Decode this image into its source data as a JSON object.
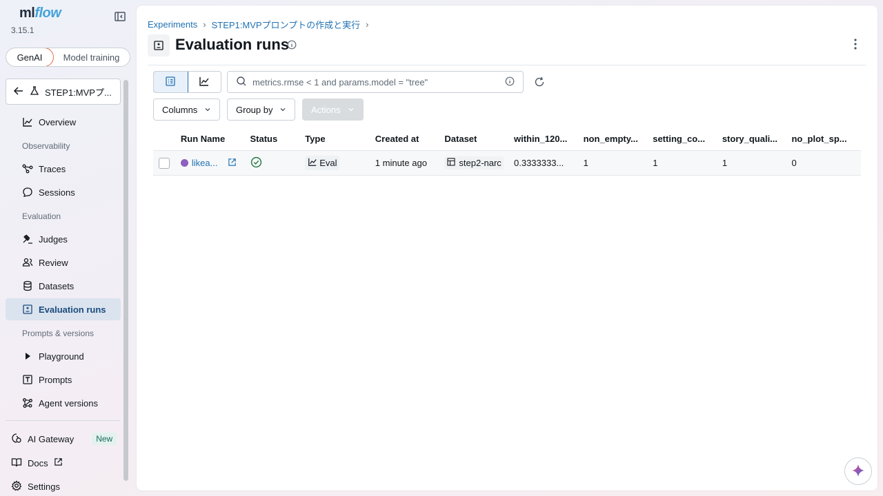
{
  "app": {
    "logo_ml": "ml",
    "logo_flow": "flow",
    "version": "3.15.1"
  },
  "mode_toggle": {
    "options": [
      "GenAI",
      "Model training"
    ],
    "selected": "GenAI"
  },
  "experiment_button": {
    "label": "STEP1:MVPプ..."
  },
  "sidebar": {
    "overview": "Overview",
    "section_observability": "Observability",
    "traces": "Traces",
    "sessions": "Sessions",
    "section_evaluation": "Evaluation",
    "judges": "Judges",
    "review": "Review",
    "datasets": "Datasets",
    "evaluation_runs": "Evaluation runs",
    "section_prompts": "Prompts & versions",
    "playground": "Playground",
    "prompts": "Prompts",
    "agent_versions": "Agent versions",
    "ai_gateway": "AI Gateway",
    "ai_gateway_badge": "New",
    "docs": "Docs",
    "settings": "Settings"
  },
  "breadcrumb": {
    "items": [
      "Experiments",
      "STEP1:MVPプロンプトの作成と実行"
    ]
  },
  "page": {
    "title": "Evaluation runs"
  },
  "toolbar": {
    "search_placeholder": "metrics.rmse < 1 and params.model = \"tree\"",
    "columns_label": "Columns",
    "group_by_label": "Group by",
    "actions_label": "Actions"
  },
  "table": {
    "headers": [
      "Run Name",
      "Status",
      "Type",
      "Created at",
      "Dataset",
      "within_120...",
      "non_empty...",
      "setting_co...",
      "story_quali...",
      "no_plot_sp..."
    ],
    "rows": [
      {
        "run_name": "likea...",
        "status": "finished",
        "type": "Eval",
        "created_at": "1 minute ago",
        "dataset": "step2-narc",
        "m1": "0.3333333...",
        "m2": "1",
        "m3": "1",
        "m4": "1",
        "m5": "0"
      }
    ]
  },
  "colors": {
    "accent": "#2272b4",
    "active_nav_bg": "#dbe3ef",
    "run_dot": "#8e5fbf",
    "status_ok": "#277c43",
    "genai_border": "#e06b4f"
  }
}
